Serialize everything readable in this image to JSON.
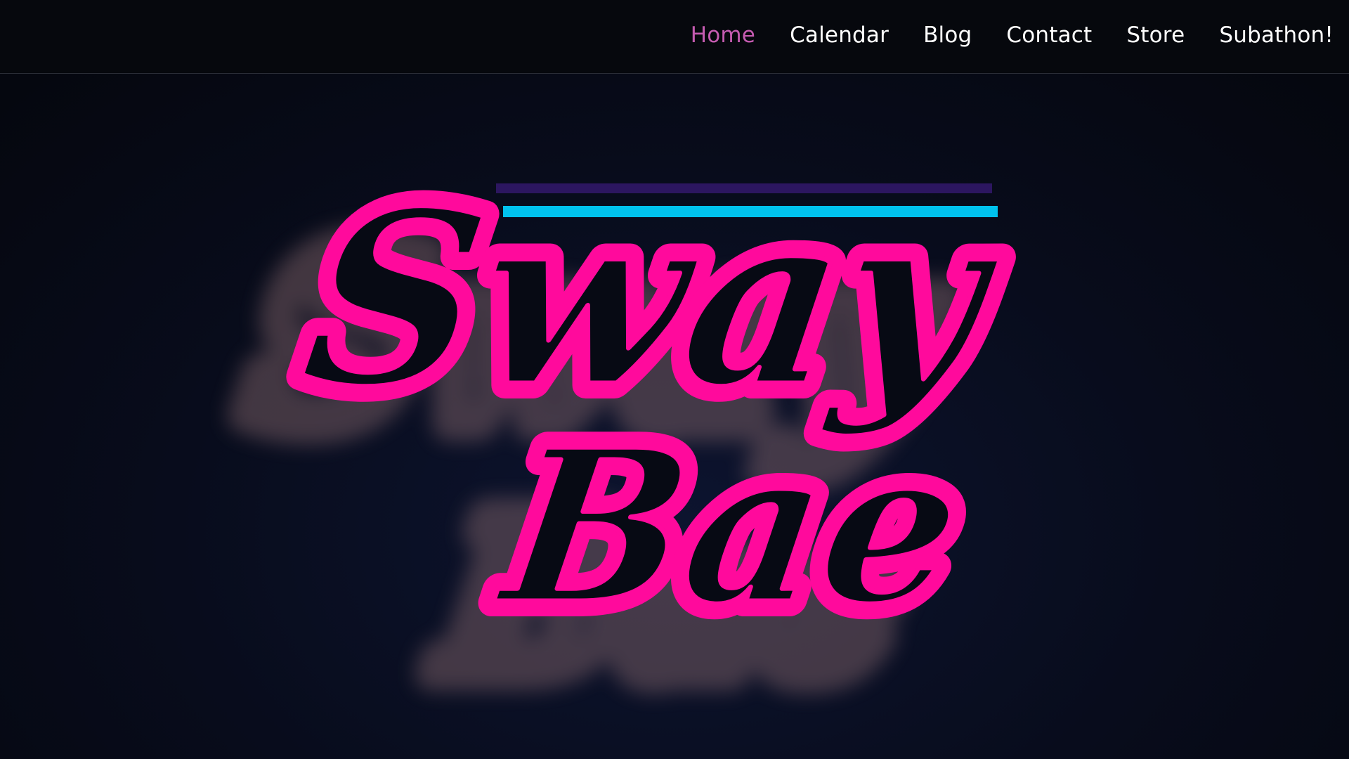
{
  "nav": {
    "items": [
      {
        "label": "Home",
        "active": true
      },
      {
        "label": "Calendar",
        "active": false
      },
      {
        "label": "Blog",
        "active": false
      },
      {
        "label": "Contact",
        "active": false
      },
      {
        "label": "Store",
        "active": false
      },
      {
        "label": "Subathon!",
        "active": false
      }
    ]
  },
  "logo": {
    "line1": "Sway",
    "line2": "Bae",
    "colors": {
      "pink": "#ff0a9c",
      "cyan": "#00c2ee",
      "purple": "#2c1660",
      "background": "#070a14"
    }
  }
}
